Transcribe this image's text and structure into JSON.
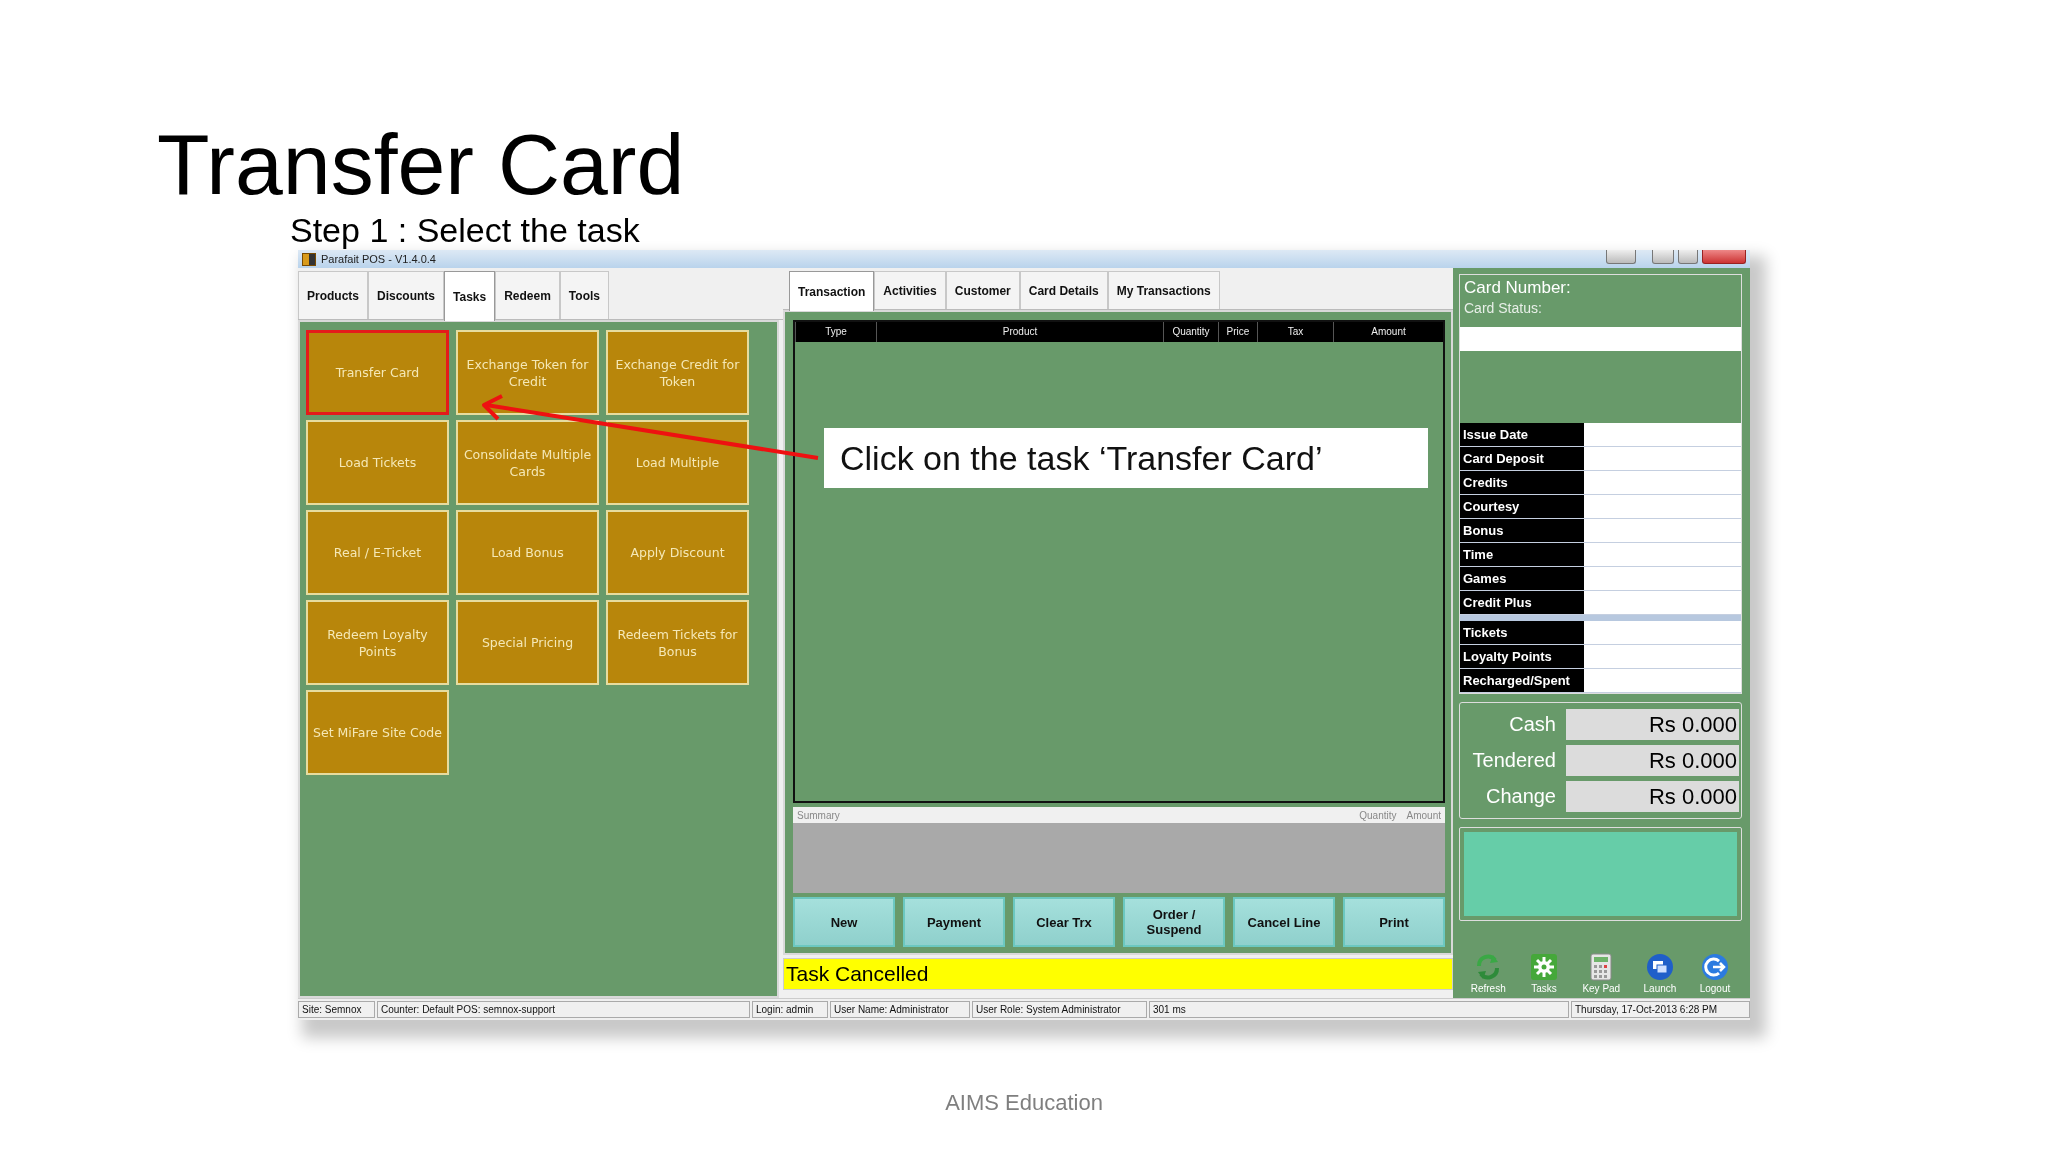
{
  "slide": {
    "title": "Transfer Card",
    "subtitle": "Step 1 : Select the task",
    "footer": "AIMS Education"
  },
  "window": {
    "title": "Parafait POS - V1.4.0.4"
  },
  "left_tabs": [
    {
      "label": "Products",
      "selected": false
    },
    {
      "label": "Discounts",
      "selected": false
    },
    {
      "label": "Tasks",
      "selected": true
    },
    {
      "label": "Redeem",
      "selected": false
    },
    {
      "label": "Tools",
      "selected": false
    }
  ],
  "tasks": [
    {
      "label": "Transfer Card",
      "highlighted": true
    },
    {
      "label": "Exchange Token for Credit",
      "highlighted": false
    },
    {
      "label": "Exchange Credit for Token",
      "highlighted": false
    },
    {
      "label": "Load Tickets",
      "highlighted": false
    },
    {
      "label": "Consolidate Multiple Cards",
      "highlighted": false
    },
    {
      "label": "Load Multiple",
      "highlighted": false
    },
    {
      "label": "Real / E-Ticket",
      "highlighted": false
    },
    {
      "label": "Load Bonus",
      "highlighted": false
    },
    {
      "label": "Apply Discount",
      "highlighted": false
    },
    {
      "label": "Redeem Loyalty Points",
      "highlighted": false
    },
    {
      "label": "Special Pricing",
      "highlighted": false
    },
    {
      "label": "Redeem Tickets for Bonus",
      "highlighted": false
    },
    {
      "label": "Set MiFare Site Code",
      "highlighted": false
    }
  ],
  "center_tabs": [
    {
      "label": "Transaction",
      "selected": true
    },
    {
      "label": "Activities",
      "selected": false
    },
    {
      "label": "Customer",
      "selected": false
    },
    {
      "label": "Card Details",
      "selected": false
    },
    {
      "label": "My Transactions",
      "selected": false
    }
  ],
  "grid": {
    "columns": [
      "Type",
      "Product",
      "Quantity",
      "Price",
      "Tax",
      "Amount"
    ]
  },
  "callout": {
    "text": "Click on the task ‘Transfer Card’"
  },
  "summary": {
    "label": "Summary",
    "columns": [
      "Quantity",
      "Amount"
    ]
  },
  "action_buttons": [
    "New",
    "Payment",
    "Clear Trx",
    "Order / Suspend",
    "Cancel Line",
    "Print"
  ],
  "message": "Task Cancelled",
  "card_panel": {
    "card_number_label": "Card Number:",
    "card_status_label": "Card Status:",
    "fields": [
      "Issue Date",
      "Card Deposit",
      "Credits",
      "Courtesy",
      "Bonus",
      "Time",
      "Games",
      "Credit Plus"
    ],
    "extra_fields": [
      "Tickets",
      "Loyalty Points",
      "Recharged/Spent"
    ]
  },
  "totals": [
    {
      "label": "Cash",
      "value": "Rs 0.000"
    },
    {
      "label": "Tendered",
      "value": "Rs 0.000"
    },
    {
      "label": "Change",
      "value": "Rs 0.000"
    }
  ],
  "toolbar": [
    {
      "label": "Refresh",
      "kind": "refresh"
    },
    {
      "label": "Tasks",
      "kind": "tasks"
    },
    {
      "label": "Key Pad",
      "kind": "keypad"
    },
    {
      "label": "Launch",
      "kind": "launch"
    },
    {
      "label": "Logout",
      "kind": "logout"
    }
  ],
  "status_bar": [
    "Site: Semnox",
    "Counter: Default POS: semnox-support",
    "Login: admin",
    "User Name: Administrator",
    "User Role: System Administrator",
    "301 ms",
    "Thursday, 17-Oct-2013 6:28 PM"
  ]
}
